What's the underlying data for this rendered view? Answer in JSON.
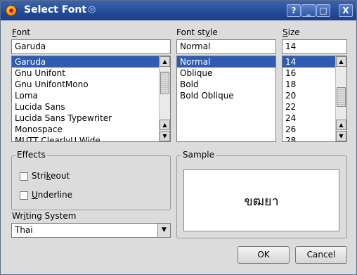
{
  "window": {
    "title": "Select Font",
    "title_buttons": [
      "?",
      "_",
      "□",
      "X"
    ]
  },
  "font": {
    "label_first": "F",
    "label_rest": "ont",
    "value": "Garuda",
    "items": [
      "Garuda",
      "Gnu Unifont",
      "Gnu UnifontMono",
      "Loma",
      "Lucida Sans",
      "Lucida Sans Typewriter",
      "Monospace",
      "MUTT ClearlyU Wide"
    ],
    "selected_index": 0
  },
  "font_style": {
    "label_before": "Font st",
    "label_ul": "y",
    "label_after": "le",
    "value": "Normal",
    "items": [
      "Normal",
      "Oblique",
      "Bold",
      "Bold Oblique"
    ],
    "selected_index": 0
  },
  "size": {
    "label_first": "S",
    "label_rest": "ize",
    "value": "14",
    "items": [
      "14",
      "16",
      "18",
      "20",
      "22",
      "24",
      "26",
      "28"
    ],
    "selected_index": 0
  },
  "effects": {
    "title": "Effects",
    "strikeout_before": "Stri",
    "strikeout_ul": "k",
    "strikeout_after": "eout",
    "underline_ul": "U",
    "underline_rest": "nderline"
  },
  "writing_system": {
    "label_before": "Wr",
    "label_ul": "i",
    "label_after": "ting System",
    "value": "Thai"
  },
  "sample": {
    "title": "Sample",
    "text": "ขฒยา"
  },
  "buttons": {
    "ok": "OK",
    "cancel": "Cancel"
  },
  "colors": {
    "titlebar": "#234a96",
    "selection": "#2f5cb0",
    "window_bg": "#dcdcdc"
  }
}
